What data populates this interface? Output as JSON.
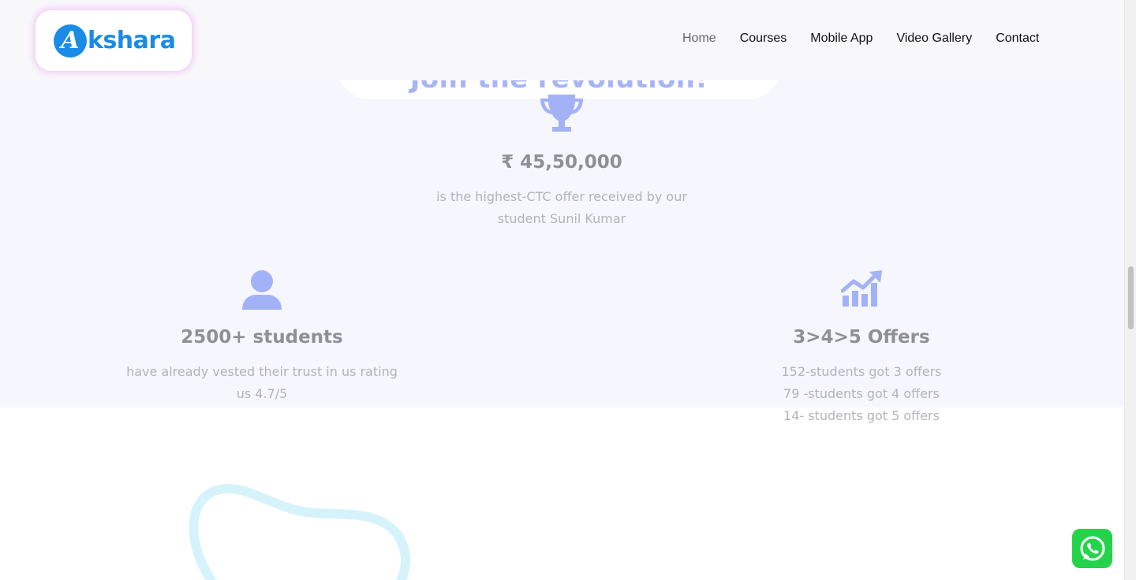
{
  "brand": {
    "logo_letter": "A",
    "logo_text": "kshara",
    "color": "#1a8be6"
  },
  "nav": {
    "items": [
      {
        "label": "Home",
        "active": true
      },
      {
        "label": "Courses",
        "active": false
      },
      {
        "label": "Mobile App",
        "active": false
      },
      {
        "label": "Video Gallery",
        "active": false
      },
      {
        "label": "Contact",
        "active": false
      }
    ]
  },
  "section": {
    "title": "Join the revolution!"
  },
  "stats": {
    "ctc": {
      "icon": "trophy-icon",
      "value": "₹ 45,50,000",
      "desc_lines": [
        "is the highest-CTC offer received by our",
        "student Sunil Kumar"
      ]
    },
    "students": {
      "icon": "user-icon",
      "value": "2500+ students",
      "desc_lines": [
        "have already vested their trust in us rating",
        "us 4.7/5"
      ]
    },
    "offers": {
      "icon": "chart-growth-icon",
      "value": "3>4>5 Offers",
      "desc_lines": [
        "152-students got 3 offers",
        "79 -students got 4 offers",
        "14- students got 5 offers"
      ]
    }
  },
  "colors": {
    "icon": "#a3b2f7",
    "band": "#f5f6fe",
    "whatsapp": "#25d34a",
    "blob": "#d6f3fb"
  },
  "floating": {
    "whatsapp_icon": "whatsapp-icon"
  }
}
